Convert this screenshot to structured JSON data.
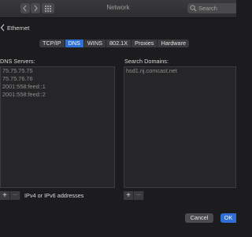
{
  "window": {
    "title": "Network"
  },
  "titlebar": {
    "back_icon": "chevron-left-icon",
    "forward_icon": "chevron-right-icon",
    "grid_icon": "grid-icon",
    "search_placeholder": "Search",
    "search_icon": "magnifier-icon"
  },
  "breadcrumb": {
    "label": "Ethernet"
  },
  "tabs": [
    {
      "label": "TCP/IP",
      "active": false
    },
    {
      "label": "DNS",
      "active": true
    },
    {
      "label": "WINS",
      "active": false
    },
    {
      "label": "802.1X",
      "active": false
    },
    {
      "label": "Proxies",
      "active": false
    },
    {
      "label": "Hardware",
      "active": false
    }
  ],
  "dns_servers": {
    "label": "DNS Servers:",
    "items": [
      "75.75.75.75",
      "75.75.76.76",
      "2001:558:feed::1",
      "2001:558:feed::2"
    ],
    "hint": "IPv4 or IPv6 addresses"
  },
  "search_domains": {
    "label": "Search Domains:",
    "items": [
      "hsd1.nj.comcast.net"
    ]
  },
  "controls": {
    "add": "+",
    "remove": "−"
  },
  "footer": {
    "cancel_label": "Cancel",
    "ok_label": "OK"
  },
  "colors": {
    "accent": "#2f6fd6",
    "background": "#1c1c1e"
  }
}
